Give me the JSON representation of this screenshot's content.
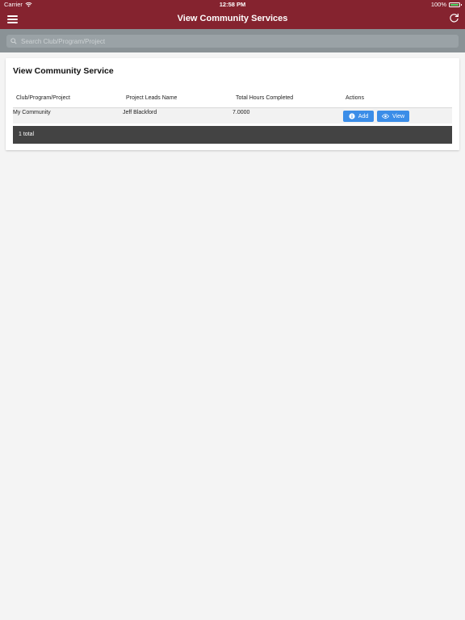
{
  "status_bar": {
    "carrier": "Carrier",
    "time": "12:58 PM",
    "battery": "100%"
  },
  "nav": {
    "title": "View Community Services",
    "menu_icon": "hamburger-icon",
    "refresh_icon": "refresh-icon"
  },
  "search": {
    "placeholder": "Search Club/Program/Project",
    "value": ""
  },
  "card": {
    "title": "View Community Service",
    "columns": [
      "Club/Program/Project",
      "Project Leads Name",
      "Total Hours Completed",
      "Actions"
    ],
    "rows": [
      {
        "project": "My Community",
        "lead": "Jeff Blackford",
        "hours": "7.0000",
        "add_label": "Add",
        "view_label": "View"
      }
    ],
    "footer": "1 total"
  },
  "colors": {
    "header": "#85232f",
    "search_bar": "#8a9296",
    "button": "#3b8de8",
    "footer": "#434343"
  }
}
